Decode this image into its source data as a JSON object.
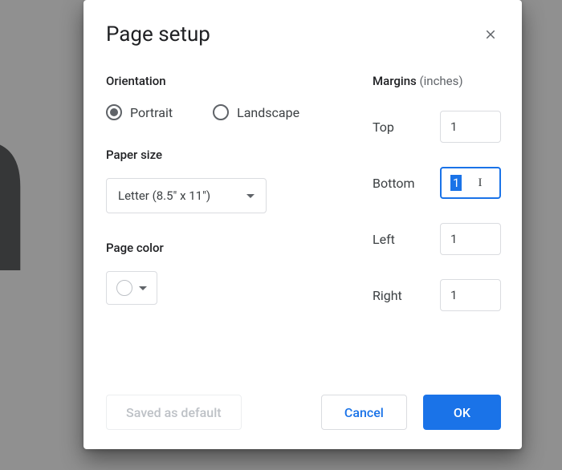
{
  "dialog": {
    "title": "Page setup",
    "orientation": {
      "title": "Orientation",
      "portrait": "Portrait",
      "landscape": "Landscape",
      "selected": "portrait"
    },
    "paper_size": {
      "title": "Paper size",
      "value": "Letter (8.5\" x 11\")"
    },
    "page_color": {
      "title": "Page color",
      "value": "#ffffff"
    },
    "margins": {
      "title": "Margins",
      "unit": "(inches)",
      "top_label": "Top",
      "top_value": "1",
      "bottom_label": "Bottom",
      "bottom_value": "1",
      "left_label": "Left",
      "left_value": "1",
      "right_label": "Right",
      "right_value": "1"
    },
    "footer": {
      "save_default": "Saved as default",
      "cancel": "Cancel",
      "ok": "OK"
    }
  }
}
